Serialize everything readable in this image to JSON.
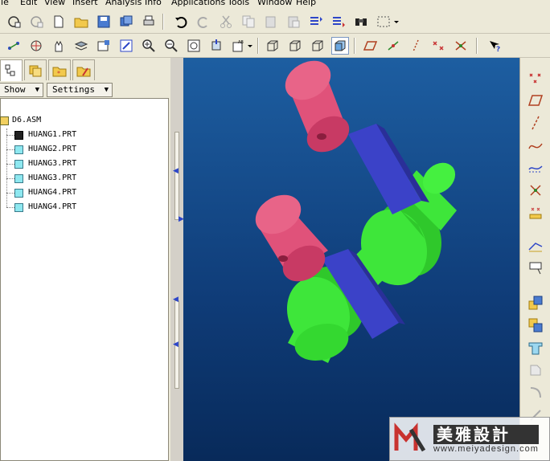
{
  "menu": {
    "items": [
      "ile",
      "Edit",
      "View",
      "Insert",
      "Analysis",
      "Info",
      "Applications",
      "Tools",
      "Window",
      "Help"
    ]
  },
  "left_panel": {
    "show_label": "Show",
    "settings_label": "Settings",
    "tree": {
      "root": "D6.ASM",
      "children": [
        "HUANG1.PRT",
        "HUANG2.PRT",
        "HUANG3.PRT",
        "HUANG3.PRT",
        "HUANG4.PRT",
        "HUANG4.PRT"
      ]
    }
  },
  "watermark": {
    "cn": "美雅設計",
    "url": "www.meiyadesign.com"
  },
  "colors": {
    "viewport_top": "#1d5ea1",
    "viewport_bottom": "#082a5a",
    "piston": "#e0527a",
    "rod": "#3b42c8",
    "crank": "#3ee63a"
  }
}
